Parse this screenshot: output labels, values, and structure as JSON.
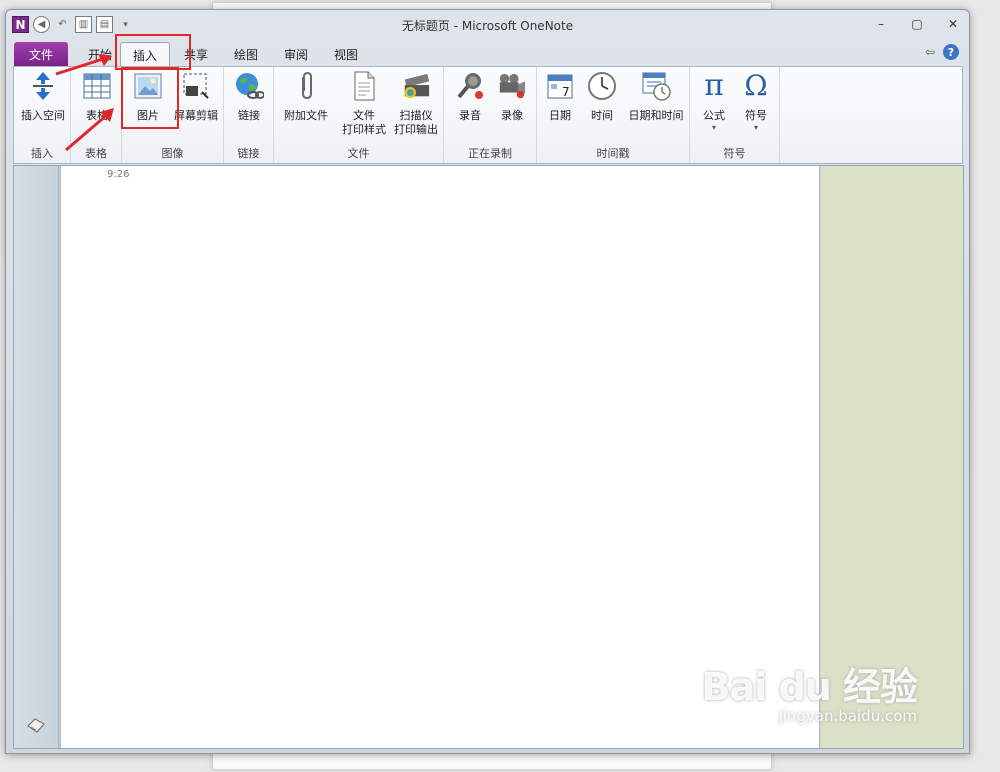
{
  "window": {
    "title": "无标题页 - Microsoft OneNote",
    "controls": [
      "–",
      "▢",
      "✕"
    ]
  },
  "qat": {
    "logo": "N"
  },
  "tabs": [
    "文件",
    "开始",
    "插入",
    "共享",
    "绘图",
    "审阅",
    "视图"
  ],
  "active_tab": "插入",
  "ribbon": {
    "groups": [
      {
        "label": "插入",
        "buttons": [
          {
            "label": "插入空间",
            "icon": "insert-space-icon"
          }
        ]
      },
      {
        "label": "表格",
        "buttons": [
          {
            "label": "表格",
            "icon": "table-icon"
          }
        ]
      },
      {
        "label": "图像",
        "buttons": [
          {
            "label": "图片",
            "icon": "picture-icon"
          },
          {
            "label": "屏幕剪辑",
            "icon": "screen-clipping-icon"
          }
        ]
      },
      {
        "label": "链接",
        "buttons": [
          {
            "label": "链接",
            "icon": "link-globe-icon"
          }
        ]
      },
      {
        "label": "文件",
        "buttons": [
          {
            "label": "附加文件",
            "icon": "paperclip-icon"
          },
          {
            "label1": "文件",
            "label2": "打印样式",
            "icon": "file-printout-icon"
          },
          {
            "label1": "扫描仪",
            "label2": "打印输出",
            "icon": "scanner-icon"
          }
        ]
      },
      {
        "label": "正在录制",
        "buttons": [
          {
            "label": "录音",
            "icon": "microphone-icon"
          },
          {
            "label": "录像",
            "icon": "video-camera-icon"
          }
        ]
      },
      {
        "label": "时间戳",
        "buttons": [
          {
            "label": "日期",
            "icon": "calendar-icon"
          },
          {
            "label": "时间",
            "icon": "clock-icon"
          },
          {
            "label": "日期和时间",
            "icon": "date-time-icon"
          }
        ]
      },
      {
        "label": "符号",
        "buttons": [
          {
            "label": "公式",
            "icon": "pi-icon",
            "glyph": "π"
          },
          {
            "label": "符号",
            "icon": "omega-icon",
            "glyph": "Ω"
          }
        ]
      }
    ],
    "calendar_day": "7"
  },
  "page": {
    "time": "9:26"
  },
  "watermark": {
    "main": "Bai du 经验",
    "sub": "jingyan.baidu.com"
  },
  "colors": {
    "annotation": "#e2262d",
    "file_tab": "#7a2488",
    "side_panel": "#d9e2c7"
  }
}
